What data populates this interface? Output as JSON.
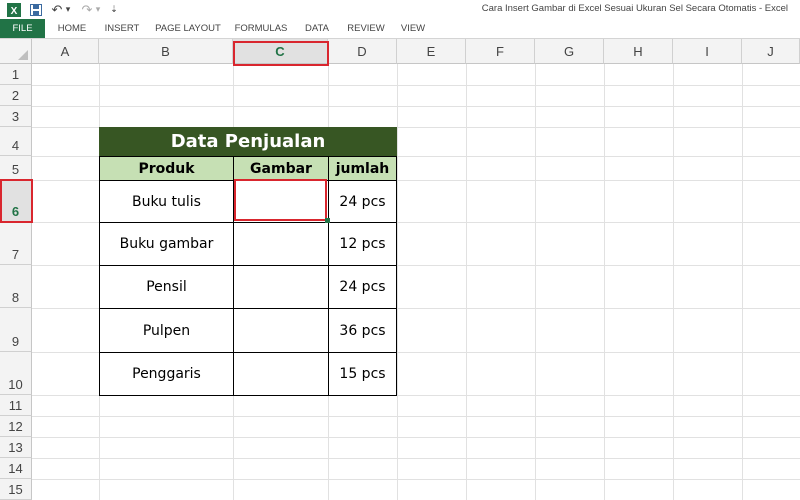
{
  "app": {
    "title": "Cara Insert Gambar di Excel Sesuai Ukuran Sel Secara Otomatis - Excel",
    "accent": "#217346",
    "quick_access": [
      {
        "name": "excel-logo-icon",
        "glyph": "X"
      },
      {
        "name": "save-icon",
        "glyph": "💾"
      },
      {
        "name": "undo-icon",
        "glyph": "↶"
      },
      {
        "name": "undo-dropdown-icon",
        "glyph": "▾"
      },
      {
        "name": "redo-icon",
        "glyph": "↷"
      },
      {
        "name": "redo-dropdown-icon",
        "glyph": "▾"
      },
      {
        "name": "customize-qat-icon",
        "glyph": "⇣"
      }
    ]
  },
  "ribbon": {
    "tabs": [
      "FILE",
      "HOME",
      "INSERT",
      "PAGE LAYOUT",
      "FORMULAS",
      "DATA",
      "REVIEW",
      "VIEW"
    ]
  },
  "sheet": {
    "columns": [
      "A",
      "B",
      "C",
      "D",
      "E",
      "F",
      "G",
      "H",
      "I",
      "J"
    ],
    "rows": [
      "1",
      "2",
      "3",
      "4",
      "5",
      "6",
      "7",
      "8",
      "9",
      "10",
      "11",
      "12",
      "13",
      "14",
      "15"
    ],
    "selected_column": "C",
    "selected_row": "6"
  },
  "table": {
    "title": "Data Penjualan",
    "title_color": "#375623",
    "header_color": "#c6e0b4",
    "headers": [
      "Produk",
      "Gambar",
      "jumlah"
    ],
    "rows": [
      {
        "produk": "Buku tulis",
        "gambar": "",
        "jumlah": "24 pcs"
      },
      {
        "produk": "Buku gambar",
        "gambar": "",
        "jumlah": "12 pcs"
      },
      {
        "produk": "Pensil",
        "gambar": "",
        "jumlah": "24 pcs"
      },
      {
        "produk": "Pulpen",
        "gambar": "",
        "jumlah": "36 pcs"
      },
      {
        "produk": "Penggaris",
        "gambar": "",
        "jumlah": "15 pcs"
      }
    ]
  },
  "highlight_color": "#d9262e"
}
